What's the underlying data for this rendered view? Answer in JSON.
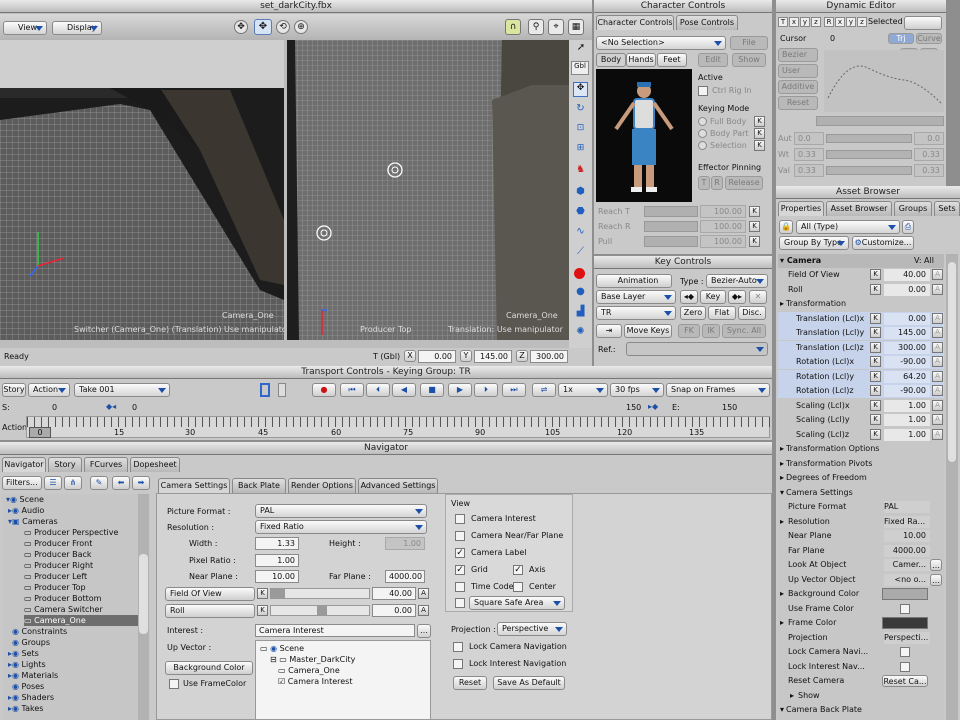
{
  "viewer": {
    "title": "set_darkCity.fbx",
    "menu_view": "View",
    "menu_display": "Display",
    "status": "Ready",
    "left_cam": "Camera_One",
    "left_caption": "Switcher (Camera_One) (Translation) Use manipulator",
    "right_cam": "Camera_One",
    "right_caption": "Producer Top",
    "right_caption2": "Translation: Use manipulator",
    "coord_mode": "T (Gbl)",
    "x": "0.00",
    "y": "145.00",
    "z": "300.00",
    "x_lbl": "X",
    "y_lbl": "Y",
    "z_lbl": "Z",
    "tool_gbl": "Gbl"
  },
  "character": {
    "title": "Character Controls",
    "tab1": "Character Controls",
    "tab2": "Pose Controls",
    "selection": "<No Selection>",
    "file": "File",
    "body_tabs": [
      "Body",
      "Hands",
      "Feet"
    ],
    "edit": "Edit",
    "show": "Show",
    "active": "Active",
    "ctrl_rig": "Ctrl Rig In",
    "keying_mode": "Keying Mode",
    "modes": [
      "Full Body",
      "Body Part",
      "Selection"
    ],
    "effector_pinning": "Effector Pinning",
    "t": "T",
    "r": "R",
    "release": "Release",
    "reach_t": "Reach T",
    "reach_r": "Reach R",
    "pull": "Pull",
    "val": "100.00"
  },
  "dyn": {
    "title": "Dynamic Editor",
    "axes": [
      "T",
      "x",
      "y",
      "z",
      "R",
      "x",
      "y",
      "z"
    ],
    "selected": "Selected",
    "cursor_lbl": "Cursor",
    "cursor": "0",
    "trj": "Trj",
    "curve": "Curve",
    "bezier": "Bezier",
    "user": "User",
    "additive": "Additive",
    "reset": "Reset",
    "a_lbl": "A",
    "b_lbl": "B",
    "rows": [
      {
        "l": "Aut",
        "a": "0.0",
        "b": "0.0"
      },
      {
        "l": "Wt",
        "a": "0.33",
        "b": "0.33"
      },
      {
        "l": "Val",
        "a": "0.33",
        "b": "0.33"
      }
    ]
  },
  "keys": {
    "title": "Key Controls",
    "animation": "Animation",
    "type_lbl": "Type :",
    "type": "Bezier-Auto",
    "layer": "Base Layer",
    "key": "Key",
    "tr": "TR",
    "zero": "Zero",
    "flat": "Flat",
    "disc": "Disc.",
    "move_keys": "Move Keys",
    "fk": "FK",
    "ik": "IK",
    "sync": "Sync. All",
    "ref": "Ref.:"
  },
  "transport": {
    "title": "Transport Controls  -  Keying Group: TR",
    "story": "Story",
    "action": "Action",
    "take": "Take 001",
    "speed": "1x",
    "fps": "30 fps",
    "snap": "Snap on Frames",
    "s_lbl": "S:",
    "start": "0",
    "s_val": "0",
    "end_val": "150",
    "e_lbl": "E:",
    "end": "150",
    "action_lbl": "Action",
    "cur": "0",
    "ticks": [
      "15",
      "30",
      "45",
      "60",
      "75",
      "90",
      "105",
      "120",
      "135"
    ]
  },
  "nav": {
    "title": "Navigator",
    "tabs": [
      "Navigator",
      "Story",
      "FCurves",
      "Dopesheet"
    ],
    "filters": "Filters...",
    "tree": [
      "Scene",
      "Audio",
      "Cameras",
      "Producer Perspective",
      "Producer Front",
      "Producer Back",
      "Producer Right",
      "Producer Left",
      "Producer Top",
      "Producer Bottom",
      "Camera Switcher",
      "Camera_One",
      "Constraints",
      "Groups",
      "Sets",
      "Lights",
      "Materials",
      "Poses",
      "Shaders",
      "Takes"
    ],
    "settings_tabs": [
      "Camera Settings",
      "Back Plate",
      "Render Options",
      "Advanced Settings"
    ],
    "picture_format_lbl": "Picture Format :",
    "picture_format": "PAL",
    "resolution_lbl": "Resolution :",
    "resolution": "Fixed Ratio",
    "width_lbl": "Width :",
    "width": "1.33",
    "height_lbl": "Height :",
    "height": "1.00",
    "pixel_ratio_lbl": "Pixel Ratio :",
    "pixel_ratio": "1.00",
    "near_lbl": "Near Plane :",
    "near": "10.00",
    "far_lbl": "Far Plane :",
    "far": "4000.00",
    "fov_lbl": "Field Of View",
    "fov": "40.00",
    "roll_lbl": "Roll",
    "roll": "0.00",
    "interest_lbl": "Interest :",
    "interest": "Camera Interest",
    "up_lbl": "Up Vector :",
    "bg_color": "Background Color",
    "use_frame": "Use FrameColor",
    "up_tree": [
      "Scene",
      "Master_DarkCity",
      "Camera_One",
      "Camera Interest"
    ],
    "view_lbl": "View",
    "view_opts": [
      "Camera Interest",
      "Camera Near/Far Plane",
      "Camera Label",
      "Grid",
      "Axis",
      "Time Code",
      "Center"
    ],
    "safe": "Square Safe Area",
    "projection_lbl": "Projection :",
    "projection": "Perspective",
    "lock_nav": "Lock Camera Navigation",
    "lock_int": "Lock Interest Navigation",
    "reset": "Reset",
    "save_default": "Save As Default",
    "k": "K",
    "a": "A"
  },
  "asset": {
    "title": "Asset Browser",
    "tabs": [
      "Properties",
      "Asset Browser",
      "Groups",
      "Sets"
    ],
    "all_type": "All (Type)",
    "group_by": "Group By Type",
    "customize": "Customize...",
    "camera": "Camera",
    "v_all": "V: All",
    "rows": [
      {
        "l": "Field Of View",
        "v": "40.00",
        "k": true,
        "i": 0
      },
      {
        "l": "Roll",
        "v": "0.00",
        "k": true,
        "i": 0
      },
      {
        "l": "Transformation",
        "v": "",
        "hdr": true,
        "i": 0
      },
      {
        "l": "Translation (Lcl)x",
        "v": "0.00",
        "k": true,
        "blue": true,
        "i": 1
      },
      {
        "l": "Translation (Lcl)y",
        "v": "145.00",
        "k": true,
        "blue": true,
        "i": 1
      },
      {
        "l": "Translation (Lcl)z",
        "v": "300.00",
        "k": true,
        "blue": true,
        "i": 1
      },
      {
        "l": "Rotation (Lcl)x",
        "v": "-90.00",
        "k": true,
        "blue": true,
        "i": 1
      },
      {
        "l": "Rotation (Lcl)y",
        "v": "64.20",
        "k": true,
        "blue": true,
        "i": 1
      },
      {
        "l": "Rotation (Lcl)z",
        "v": "-90.00",
        "k": true,
        "blue": true,
        "i": 1
      },
      {
        "l": "Scaling (Lcl)x",
        "v": "1.00",
        "k": true,
        "i": 1
      },
      {
        "l": "Scaling (Lcl)y",
        "v": "1.00",
        "k": true,
        "i": 1
      },
      {
        "l": "Scaling (Lcl)z",
        "v": "1.00",
        "k": true,
        "i": 1
      },
      {
        "l": "Transformation Options",
        "v": "",
        "hdr": true,
        "i": 0
      },
      {
        "l": "Transformation Pivots",
        "v": "",
        "hdr": true,
        "i": 0
      },
      {
        "l": "Degrees of Freedom",
        "v": "",
        "hdr": true,
        "i": 0
      },
      {
        "l": "Camera Settings",
        "v": "",
        "hdr": true,
        "open": true,
        "i": 0
      },
      {
        "l": "Picture Format",
        "v": "PAL",
        "dd": true,
        "i": 0
      },
      {
        "l": "Resolution",
        "v": "Fixed Ra...",
        "dd": true,
        "i": 0
      },
      {
        "l": "Near Plane",
        "v": "10.00",
        "i": 0
      },
      {
        "l": "Far Plane",
        "v": "4000.00",
        "i": 0
      },
      {
        "l": "Look At Object",
        "v": "Camer...",
        "i": 0
      },
      {
        "l": "Up Vector Object",
        "v": "<no o...",
        "i": 0
      },
      {
        "l": "Background Color",
        "v": "",
        "swatch": "#aaaaaa",
        "i": 0
      },
      {
        "l": "Use Frame Color",
        "v": "",
        "chk": true,
        "i": 0
      },
      {
        "l": "Frame Color",
        "v": "",
        "swatch": "#3a3a3a",
        "i": 0
      },
      {
        "l": "Projection",
        "v": "Perspecti...",
        "dd": true,
        "i": 0
      },
      {
        "l": "Lock Camera Navi...",
        "v": "",
        "chk": true,
        "i": 0
      },
      {
        "l": "Lock Interest Nav...",
        "v": "",
        "chk": true,
        "i": 0
      },
      {
        "l": "Reset Camera",
        "v": "Reset Ca...",
        "btn": true,
        "i": 0
      },
      {
        "l": "Show",
        "v": "",
        "hdr": true,
        "i": 1
      },
      {
        "l": "Camera Back Plate",
        "v": "",
        "hdr": true,
        "open": true,
        "i": 0
      }
    ]
  }
}
